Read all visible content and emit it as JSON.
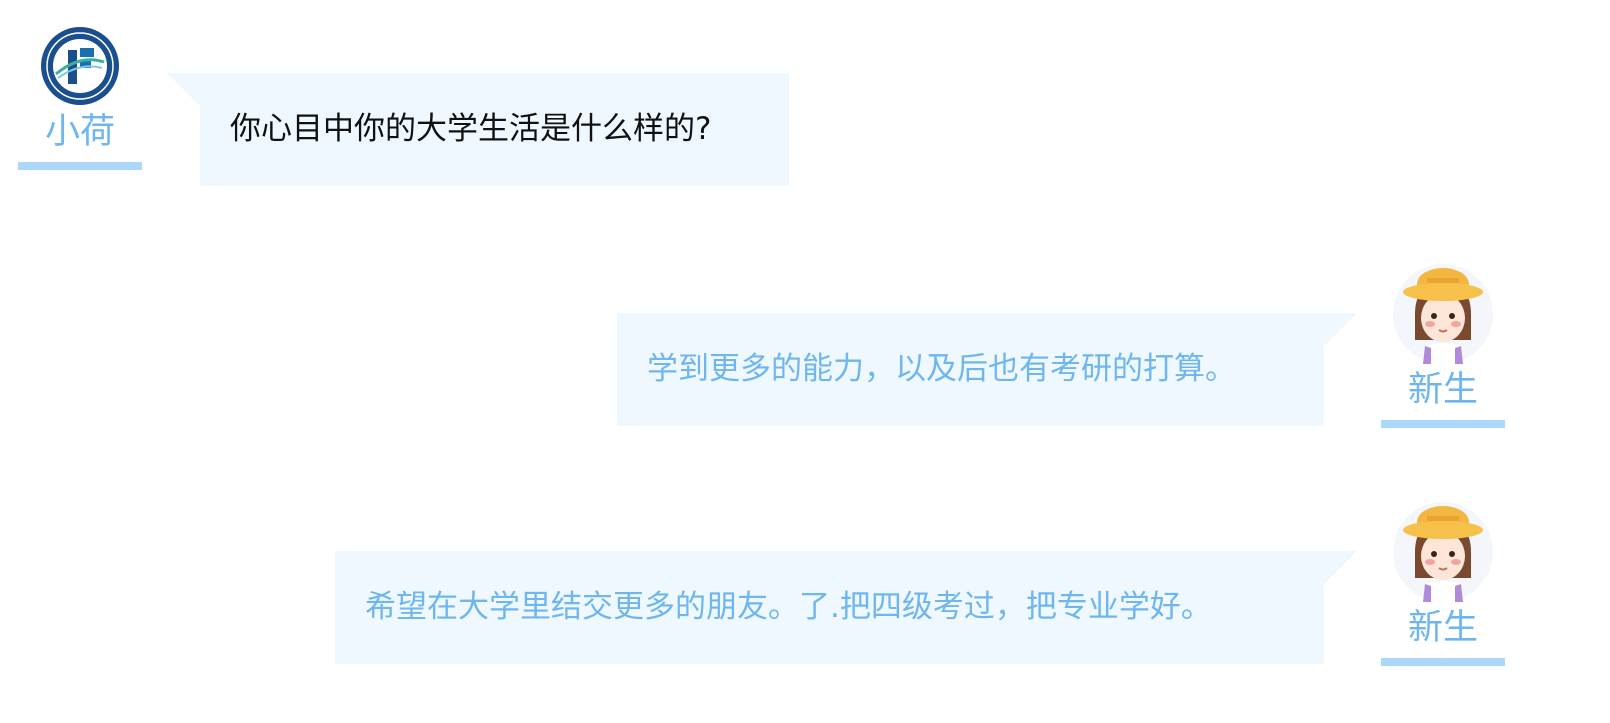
{
  "colors": {
    "bubble_bg": "#eef8fe",
    "accent_blue": "#6fb6ef",
    "underline_blue": "#a9d8f8",
    "question_text": "#111111",
    "logo_navy": "#1a4e8c"
  },
  "messages": [
    {
      "speaker": "小荷",
      "avatar": "university-logo-icon",
      "side": "left",
      "text": "你心目中你的大学生活是什么样的?"
    },
    {
      "speaker": "新生",
      "avatar": "student-girl-avatar",
      "side": "right",
      "text": "学到更多的能力，以及后也有考研的打算。"
    },
    {
      "speaker": "新生",
      "avatar": "student-girl-avatar",
      "side": "right",
      "text": "希望在大学里结交更多的朋友。了.把四级考过，把专业学好。"
    }
  ]
}
